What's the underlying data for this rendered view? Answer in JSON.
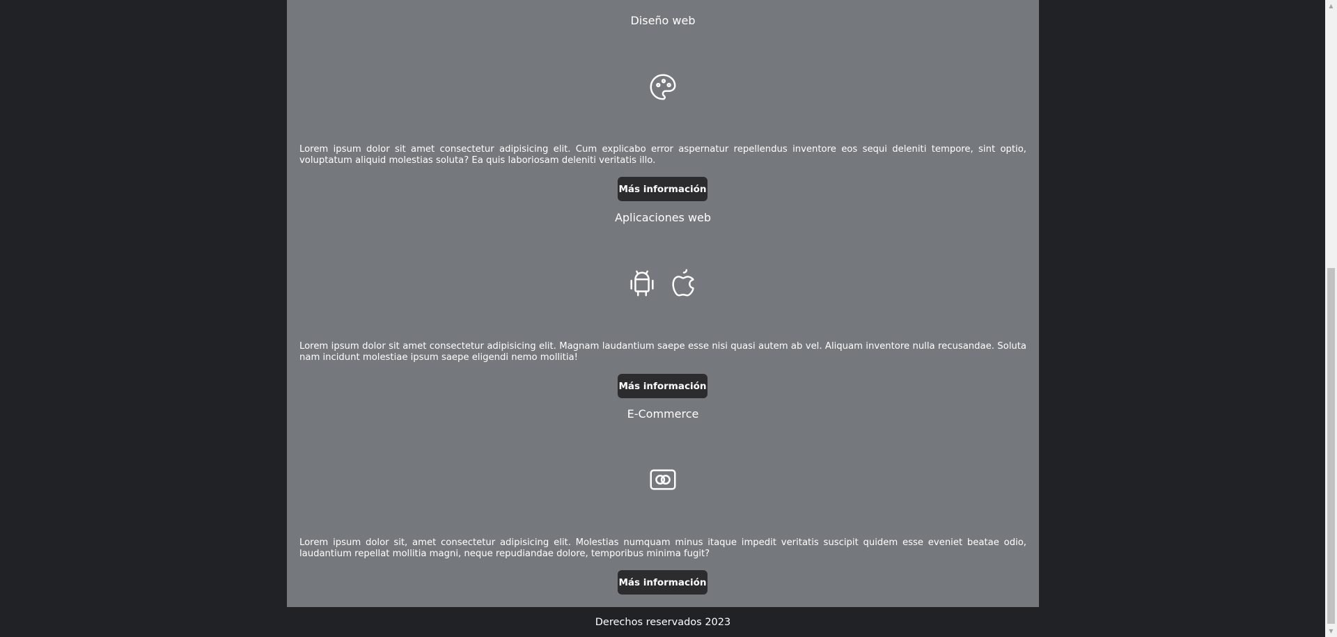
{
  "services": [
    {
      "title": "Diseño web",
      "icons": [
        "palette-icon"
      ],
      "description": "Lorem ipsum dolor sit amet consectetur adipisicing elit. Cum explicabo error aspernatur repellendus inventore eos sequi deleniti tempore, sint optio, voluptatum aliquid molestias soluta? Ea quis laboriosam deleniti veritatis illo.",
      "button_label": "Más información"
    },
    {
      "title": "Aplicaciones web",
      "icons": [
        "android-icon",
        "apple-icon"
      ],
      "description": "Lorem ipsum dolor sit amet consectetur adipisicing elit. Magnam laudantium saepe esse nisi quasi autem ab vel. Aliquam inventore nulla recusandae. Soluta nam incidunt molestiae ipsum saepe eligendi nemo mollitia!",
      "button_label": "Más información"
    },
    {
      "title": "E-Commerce",
      "icons": [
        "credit-card-icon"
      ],
      "description": "Lorem ipsum dolor sit, amet consectetur adipisicing elit. Molestias numquam minus itaque impedit veritatis suscipit quidem esse eveniet beatae odio, laudantium repellat mollitia magni, neque repudiandae dolore, temporibus minima fugit?",
      "button_label": "Más información"
    }
  ],
  "footer": {
    "text": "Derechos reservados 2023"
  },
  "colors": {
    "page_background": "#212226",
    "content_background": "#75787c",
    "button_background": "#2c2c2f",
    "text": "#ffffff"
  }
}
